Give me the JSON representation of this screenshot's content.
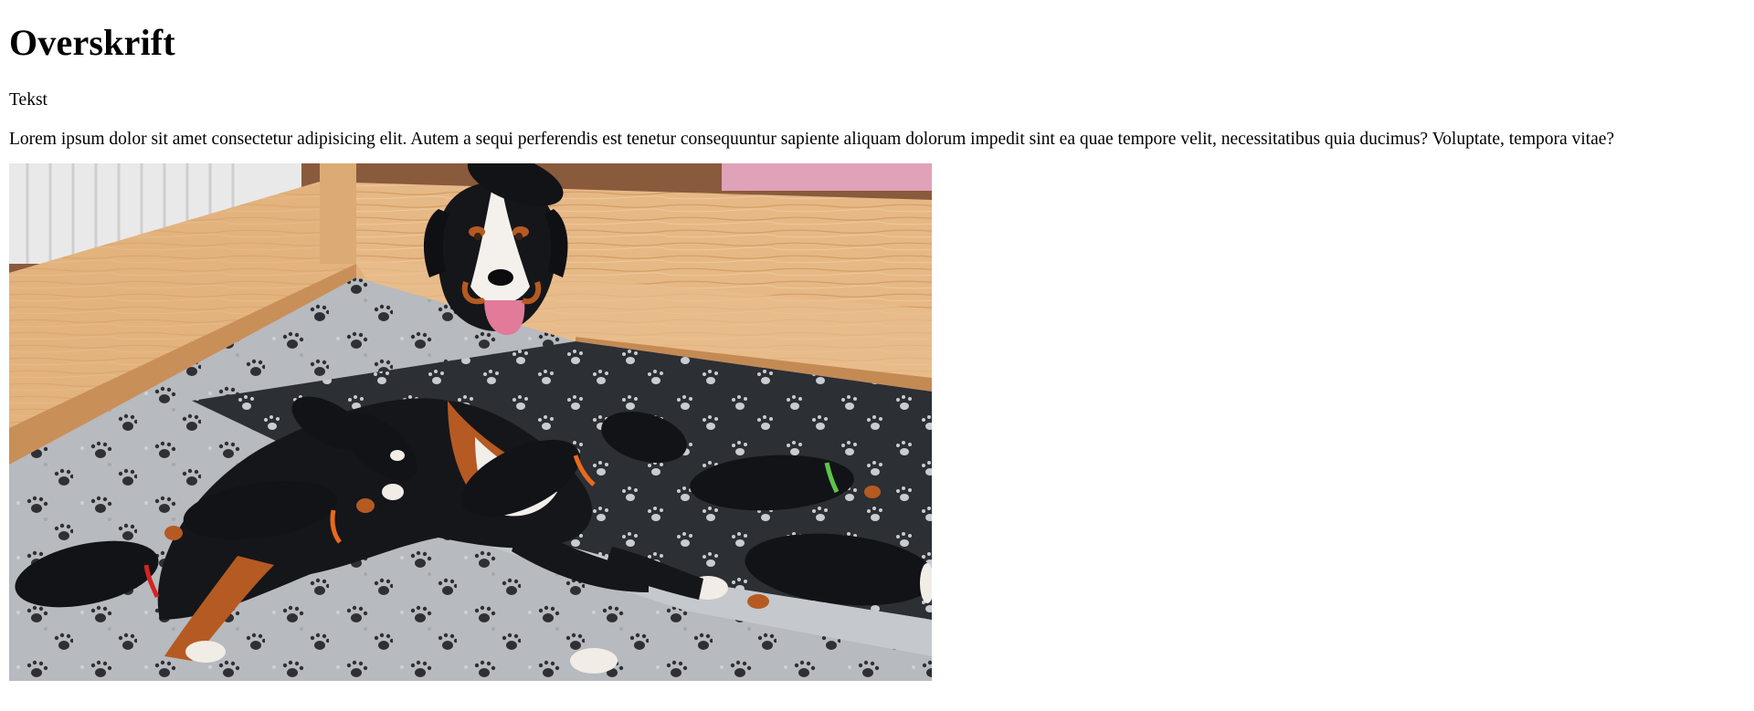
{
  "heading": "Overskrift",
  "subheading": "Tekst",
  "paragraph": "Lorem ipsum dolor sit amet consectetur adipisicing elit. Autem a sequi perferendis est tenetur consequuntur sapiente aliquam dolorum impedit sint ea quae tempore velit, necessitatibus quia ducimus? Voluptate, tempora vitae?",
  "colors": {
    "text": "#000000",
    "background": "#ffffff",
    "wood": "#e3b27a",
    "blanket": "#b9bcc0",
    "dark_blanket": "#2f3237"
  }
}
